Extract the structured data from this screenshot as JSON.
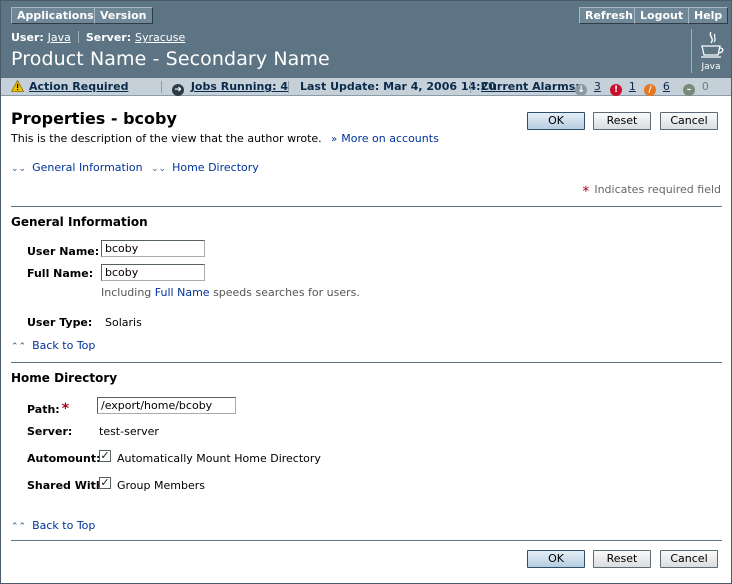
{
  "masthead": {
    "app_buttons": [
      "Applications",
      "Version"
    ],
    "right_buttons": [
      "Refresh",
      "Logout",
      "Help"
    ],
    "user_label": "User:",
    "user_value": "Java",
    "server_label": "Server:",
    "server_value": "Syracuse",
    "product_title": "Product Name - Secondary Name",
    "logo_text": "Java"
  },
  "status": {
    "action_required": "Action Required",
    "jobs_running": "Jobs Running: 4",
    "last_update": "Last Update: Mar 4, 2006 14:20",
    "current_alarms": "Current Alarms:",
    "alarm_counts": [
      "3",
      "1",
      "6",
      "0"
    ],
    "alarm_colors": [
      "#8a9aa5",
      "#c8102e",
      "#e87722",
      "#7a8a7a"
    ]
  },
  "page": {
    "title": "Properties - bcoby",
    "description": "This is the description of the view that the author wrote.",
    "more_link": "More on accounts",
    "ok": "OK",
    "reset": "Reset",
    "cancel": "Cancel",
    "jump_general": "General Information",
    "jump_home": "Home Directory",
    "required_note": "Indicates required field",
    "back_to_top": "Back to Top"
  },
  "general": {
    "title": "General Information",
    "user_name_label": "User Name:",
    "user_name_value": "bcoby",
    "full_name_label": "Full Name:",
    "full_name_value": "bcoby",
    "help_prefix": "Including",
    "help_link": "Full Name",
    "help_suffix": "speeds searches for users.",
    "user_type_label": "User Type:",
    "user_type_value": "Solaris"
  },
  "home": {
    "title": "Home Directory",
    "path_label": "Path:",
    "path_value": "/export/home/bcoby",
    "server_label": "Server:",
    "server_value": "test-server",
    "automount_label": "Automount:",
    "automount_text": "Automatically Mount Home Directory",
    "automount_checked": true,
    "shared_label": "Shared With:",
    "shared_text": "Group Members",
    "shared_checked": true
  },
  "colors": {
    "masthead": "#5d7484",
    "statusbar": "#c5d0d8",
    "link": "#003399",
    "required": "#a8001e"
  }
}
